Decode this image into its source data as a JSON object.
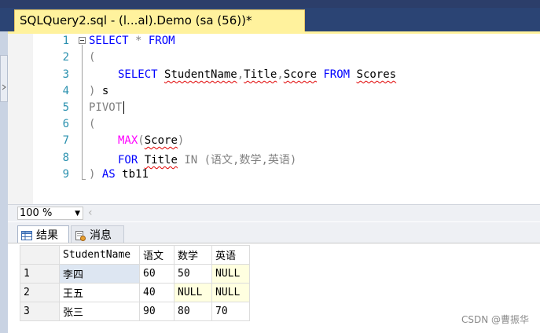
{
  "window": {
    "tab_title": "SQLQuery2.sql - (l...al).Demo (sa (56))*"
  },
  "editor": {
    "lines": [
      {
        "num": "1"
      },
      {
        "num": "2"
      },
      {
        "num": "3"
      },
      {
        "num": "4"
      },
      {
        "num": "5"
      },
      {
        "num": "6"
      },
      {
        "num": "7"
      },
      {
        "num": "8"
      },
      {
        "num": "9"
      }
    ],
    "tokens": {
      "select": "SELECT",
      "star": " * ",
      "from": "FROM",
      "lparen": "(",
      "rparen": ")",
      "student_name": "StudentName",
      "comma": ",",
      "title": "Title",
      "score": "Score",
      "scores": "Scores",
      "alias_s": " s",
      "pivot": "PIVOT",
      "max": "MAX",
      "for": "FOR",
      "in": "IN",
      "in_list": "(语文,数学,英语)",
      "as": "AS",
      "alias_tb": " tb11"
    }
  },
  "zoom": {
    "value": "100 %"
  },
  "results_tabs": [
    {
      "label": "结果",
      "icon": "grid-icon"
    },
    {
      "label": "消息",
      "icon": "messages-icon"
    }
  ],
  "results": {
    "columns": [
      "StudentName",
      "语文",
      "数学",
      "英语"
    ],
    "rows": [
      {
        "rn": "1",
        "cells": [
          "李四",
          "60",
          "50",
          "NULL"
        ]
      },
      {
        "rn": "2",
        "cells": [
          "王五",
          "40",
          "NULL",
          "NULL"
        ]
      },
      {
        "rn": "3",
        "cells": [
          "张三",
          "90",
          "80",
          "70"
        ]
      }
    ]
  },
  "watermark": "CSDN @曹振华",
  "colors": {
    "keyword": "#0000ff",
    "function": "#ff00ff",
    "line_number": "#2b91af",
    "tab_active": "#fff29d",
    "null_cell": "#ffffe0"
  }
}
